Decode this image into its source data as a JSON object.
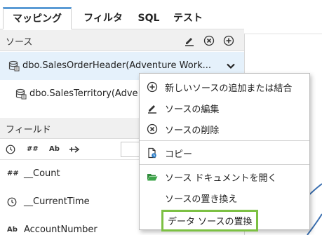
{
  "tabs": [
    {
      "label": "マッピング"
    },
    {
      "label": "フィルタ"
    },
    {
      "label": "SQL"
    },
    {
      "label": "テスト"
    }
  ],
  "sources": {
    "title": "ソース",
    "items": [
      {
        "label": "dbo.SalesOrderHeader(Adventure Work..."
      },
      {
        "label": "dbo.SalesTerritory(Adve"
      }
    ]
  },
  "fields": {
    "title": "フィールド",
    "toolbar": {
      "hash": "##",
      "ab": "Ab"
    },
    "search_value": "",
    "items": [
      {
        "type": "##",
        "label": "__Count"
      },
      {
        "type": "clock",
        "label": "__CurrentTime"
      },
      {
        "type": "Ab",
        "label": "AccountNumber"
      }
    ]
  },
  "context_menu": {
    "items": [
      {
        "label": "新しいソースの追加または結合",
        "icon": "plus-circle-icon"
      },
      {
        "label": "ソースの編集",
        "icon": "pencil-icon"
      },
      {
        "label": "ソースの削除",
        "icon": "x-circle-icon"
      },
      {
        "label": "コピー",
        "icon": "copy-icon"
      },
      {
        "label": "ソース ドキュメントを開く",
        "icon": "folder-open-icon"
      },
      {
        "label": "ソースの置き換え",
        "icon": ""
      },
      {
        "label": "データ ソースの置換",
        "icon": ""
      }
    ]
  },
  "colors": {
    "selected_row": "#e5f1fb",
    "active_tab_accent": "#5b9bd5",
    "highlight_box": "#7cc043",
    "folder_green": "#2e8b3a"
  }
}
